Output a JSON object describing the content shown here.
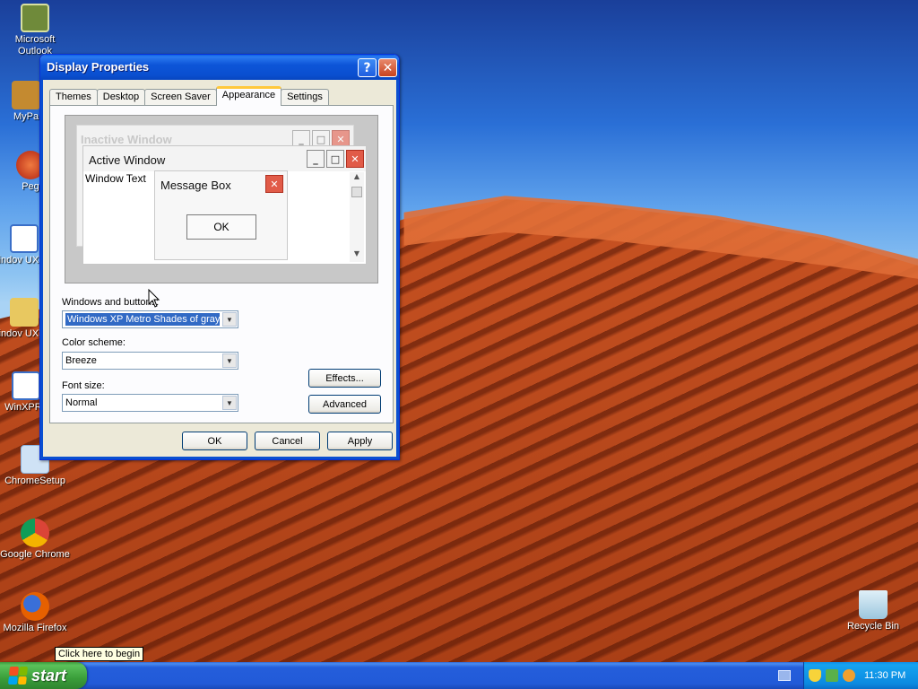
{
  "desktop": {
    "icons": [
      {
        "label": "Microsoft Outlook",
        "icon": "outlook-icon",
        "color": "#6f8a3a"
      },
      {
        "label": "MyPa",
        "icon": "my-pictures-icon",
        "color": "#c48a30"
      },
      {
        "label": "Peg",
        "icon": "pegasus-icon",
        "color": "#d84020"
      },
      {
        "label": "Windov UXTher",
        "icon": "window-app-icon",
        "color": "#3a6fc8"
      },
      {
        "label": "Windov UXTher",
        "icon": "folder-icon",
        "color": "#e8c860"
      },
      {
        "label": "WinXPRa",
        "icon": "window-app-icon",
        "color": "#3a6fc8"
      },
      {
        "label": "ChromeSetup",
        "icon": "installer-icon",
        "color": "#8ab4e0"
      },
      {
        "label": "Google Chrome",
        "icon": "chrome-icon",
        "color": "#db4437"
      },
      {
        "label": "Mozilla Firefox",
        "icon": "firefox-icon",
        "color": "#e66000"
      }
    ],
    "recycle_bin": "Recycle Bin"
  },
  "dialog": {
    "title": "Display Properties",
    "help_glyph": "?",
    "close_glyph": "✕",
    "tabs": [
      "Themes",
      "Desktop",
      "Screen Saver",
      "Appearance",
      "Settings"
    ],
    "active_tab": "Appearance",
    "preview": {
      "inactive_title": "Inactive Window",
      "active_title": "Active Window",
      "window_text": "Window Text",
      "message_box_title": "Message Box",
      "message_box_ok": "OK"
    },
    "windows_and_buttons_label": "Windows and buttons:",
    "windows_and_buttons_value": "Windows XP Metro Shades of gray s",
    "color_scheme_label": "Color scheme:",
    "color_scheme_value": "Breeze",
    "font_size_label": "Font size:",
    "font_size_value": "Normal",
    "effects_button": "Effects...",
    "advanced_button": "Advanced",
    "ok_button": "OK",
    "cancel_button": "Cancel",
    "apply_button": "Apply"
  },
  "taskbar": {
    "start_label": "start",
    "tooltip": "Click here to begin",
    "clock": "11:30 PM"
  }
}
